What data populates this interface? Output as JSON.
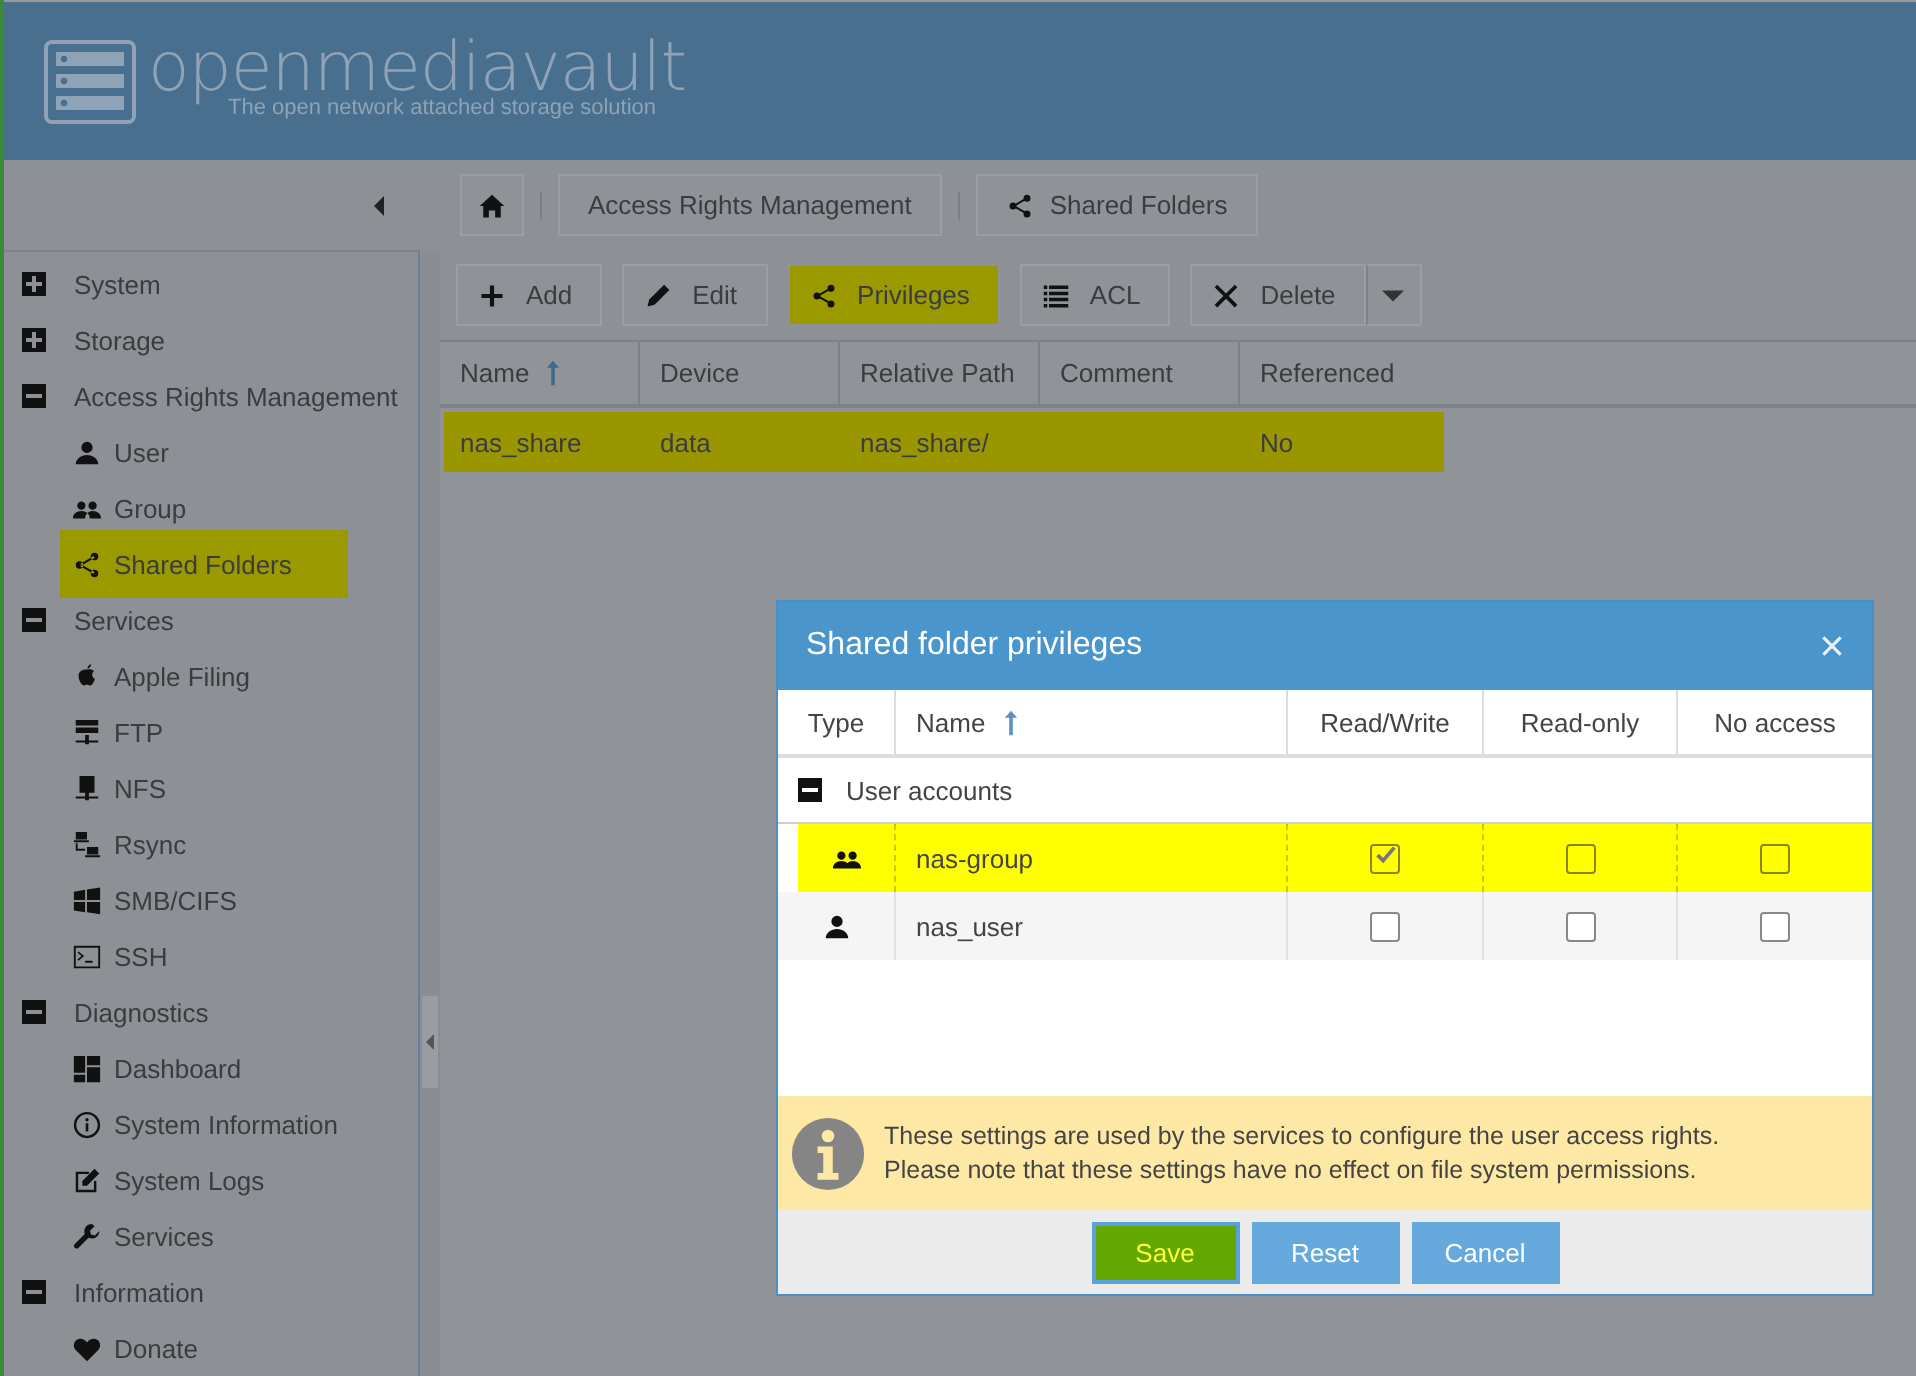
{
  "header": {
    "logo_text": "openmediavault",
    "tagline": "The open network attached storage solution"
  },
  "breadcrumbs": [
    "Access Rights Management",
    "Shared Folders"
  ],
  "sidebar": {
    "items": [
      {
        "label": "System",
        "expanded": false
      },
      {
        "label": "Storage",
        "expanded": false
      },
      {
        "label": "Access Rights Management",
        "expanded": true,
        "children": [
          {
            "label": "User",
            "selected": false
          },
          {
            "label": "Group",
            "selected": false
          },
          {
            "label": "Shared Folders",
            "selected": true
          }
        ]
      },
      {
        "label": "Services",
        "expanded": true,
        "children": [
          {
            "label": "Apple Filing",
            "selected": false
          },
          {
            "label": "FTP",
            "selected": false
          },
          {
            "label": "NFS",
            "selected": false
          },
          {
            "label": "Rsync",
            "selected": false
          },
          {
            "label": "SMB/CIFS",
            "selected": false
          },
          {
            "label": "SSH",
            "selected": false
          }
        ]
      },
      {
        "label": "Diagnostics",
        "expanded": true,
        "children": [
          {
            "label": "Dashboard",
            "selected": false
          },
          {
            "label": "System Information",
            "selected": false
          },
          {
            "label": "System Logs",
            "selected": false
          },
          {
            "label": "Services",
            "selected": false
          }
        ]
      },
      {
        "label": "Information",
        "expanded": true,
        "children": [
          {
            "label": "Donate",
            "selected": false
          }
        ]
      }
    ]
  },
  "toolbar": [
    {
      "label": "Add",
      "highlighted": false
    },
    {
      "label": "Edit",
      "highlighted": false
    },
    {
      "label": "Privileges",
      "highlighted": true
    },
    {
      "label": "ACL",
      "highlighted": false
    },
    {
      "label": "Delete",
      "highlighted": false,
      "dropdown": true
    }
  ],
  "table": {
    "columns": [
      {
        "label": "Name",
        "sorted": true
      },
      {
        "label": "Device",
        "sorted": false
      },
      {
        "label": "Relative Path",
        "sorted": false
      },
      {
        "label": "Comment",
        "sorted": false
      },
      {
        "label": "Referenced",
        "sorted": false
      }
    ],
    "rows": [
      {
        "cells": [
          "nas_share",
          "data",
          "nas_share/",
          "",
          "No"
        ],
        "selected": true
      }
    ]
  },
  "dialog": {
    "title": "Shared folder privileges",
    "columns": [
      {
        "label": "Type",
        "sorted": false
      },
      {
        "label": "Name",
        "sorted": true
      },
      {
        "label": "Read/Write",
        "sorted": false
      },
      {
        "label": "Read-only",
        "sorted": false
      },
      {
        "label": "No access",
        "sorted": false
      }
    ],
    "group": {
      "label": "User accounts",
      "expanded": true
    },
    "rows": [
      {
        "kind": "group",
        "name": "nas-group",
        "selected": true,
        "read_write": true,
        "read_only": false,
        "no_access": false
      },
      {
        "kind": "user",
        "name": "nas_user",
        "selected": false,
        "read_write": false,
        "read_only": false,
        "no_access": false
      }
    ],
    "info_lines": [
      "These settings are used by the services to configure the user access rights.",
      "Please note that these settings have no effect on file system permissions."
    ],
    "buttons": [
      {
        "label": "Save",
        "primary": true
      },
      {
        "label": "Reset",
        "primary": false
      },
      {
        "label": "Cancel",
        "primary": false
      }
    ]
  }
}
